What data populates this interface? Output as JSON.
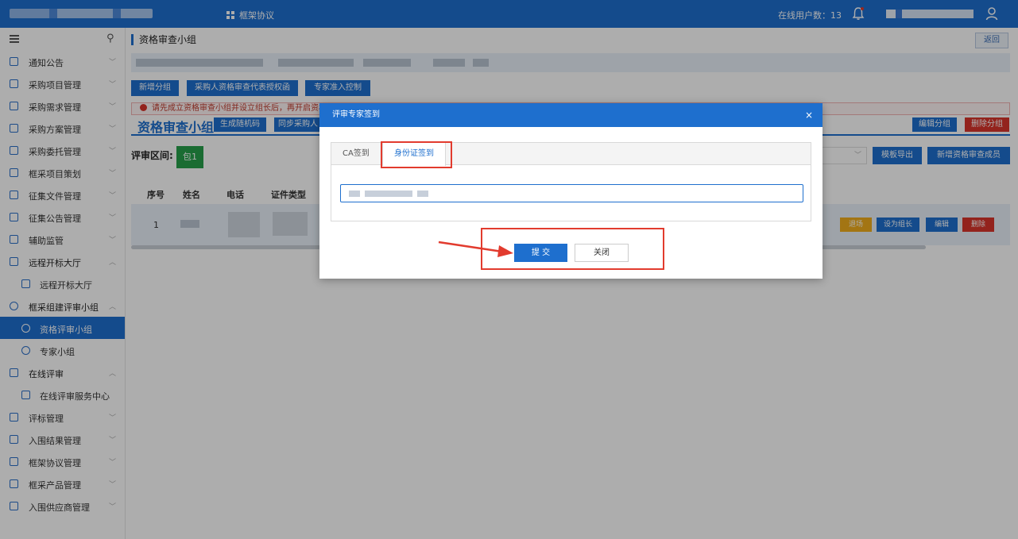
{
  "topbar": {
    "menu_label": "框架协议",
    "online_label": "在线用户数：13",
    "colors": {
      "bar": "#1e6fce"
    }
  },
  "sidebar": {
    "items": [
      {
        "label": "通知公告",
        "icon": "folder-icon"
      },
      {
        "label": "采购项目管理",
        "icon": "folder-icon"
      },
      {
        "label": "采购需求管理",
        "icon": "doc-icon"
      },
      {
        "label": "采购方案管理",
        "icon": "doc-icon"
      },
      {
        "label": "采购委托管理",
        "icon": "doc-icon"
      },
      {
        "label": "框采项目策划",
        "icon": "folder-icon"
      },
      {
        "label": "征集文件管理",
        "icon": "doc-icon"
      },
      {
        "label": "征集公告管理",
        "icon": "doc-icon"
      },
      {
        "label": "辅助监管",
        "icon": "monitor-icon"
      },
      {
        "label": "远程开标大厅",
        "icon": "doc-icon"
      },
      {
        "label": "远程开标大厅",
        "icon": "doc-icon"
      },
      {
        "label": "框采组建评审小组",
        "icon": "group-icon"
      },
      {
        "label": "资格评审小组",
        "icon": "group-icon"
      },
      {
        "label": "专家小组",
        "icon": "group-icon"
      },
      {
        "label": "在线评审",
        "icon": "monitor-icon"
      },
      {
        "label": "在线评审服务中心",
        "icon": "monitor-icon"
      },
      {
        "label": "评标管理",
        "icon": "doc-icon"
      },
      {
        "label": "入围结果管理",
        "icon": "chart-icon"
      },
      {
        "label": "框架协议管理",
        "icon": "tree-icon"
      },
      {
        "label": "框采产品管理",
        "icon": "doc-icon"
      },
      {
        "label": "入围供应商管理",
        "icon": "truck-icon"
      }
    ]
  },
  "main": {
    "page_title": "资格审查小组",
    "back_label": "返回",
    "toolbar": {
      "add_group": "新增分组",
      "purchaser_auth": "采购人资格审查代表授权函",
      "expert_access": "专家准入控制"
    },
    "warning": "请先成立资格审查小组并设立组长后，再开启资格审",
    "section_title": "资格审查小组",
    "gen_code": "生成随机码",
    "sync_label": "同步采购人",
    "edit_group": "编辑分组",
    "delete_group": "删除分组",
    "review_range_label": "评审区间:",
    "package_label": "包1",
    "template_export": "模板导出",
    "add_member": "新增资格审查成员",
    "table": {
      "headers": [
        "序号",
        "姓名",
        "电话",
        "证件类型"
      ],
      "row_no": "1",
      "actions": [
        "退场",
        "设为组长",
        "编辑",
        "删除"
      ]
    }
  },
  "modal": {
    "title": "评审专家签到",
    "close_glyph": "×",
    "tabs": [
      "CA签到",
      "身份证签到"
    ],
    "submit_label": "提 交",
    "close_label": "关闭"
  }
}
